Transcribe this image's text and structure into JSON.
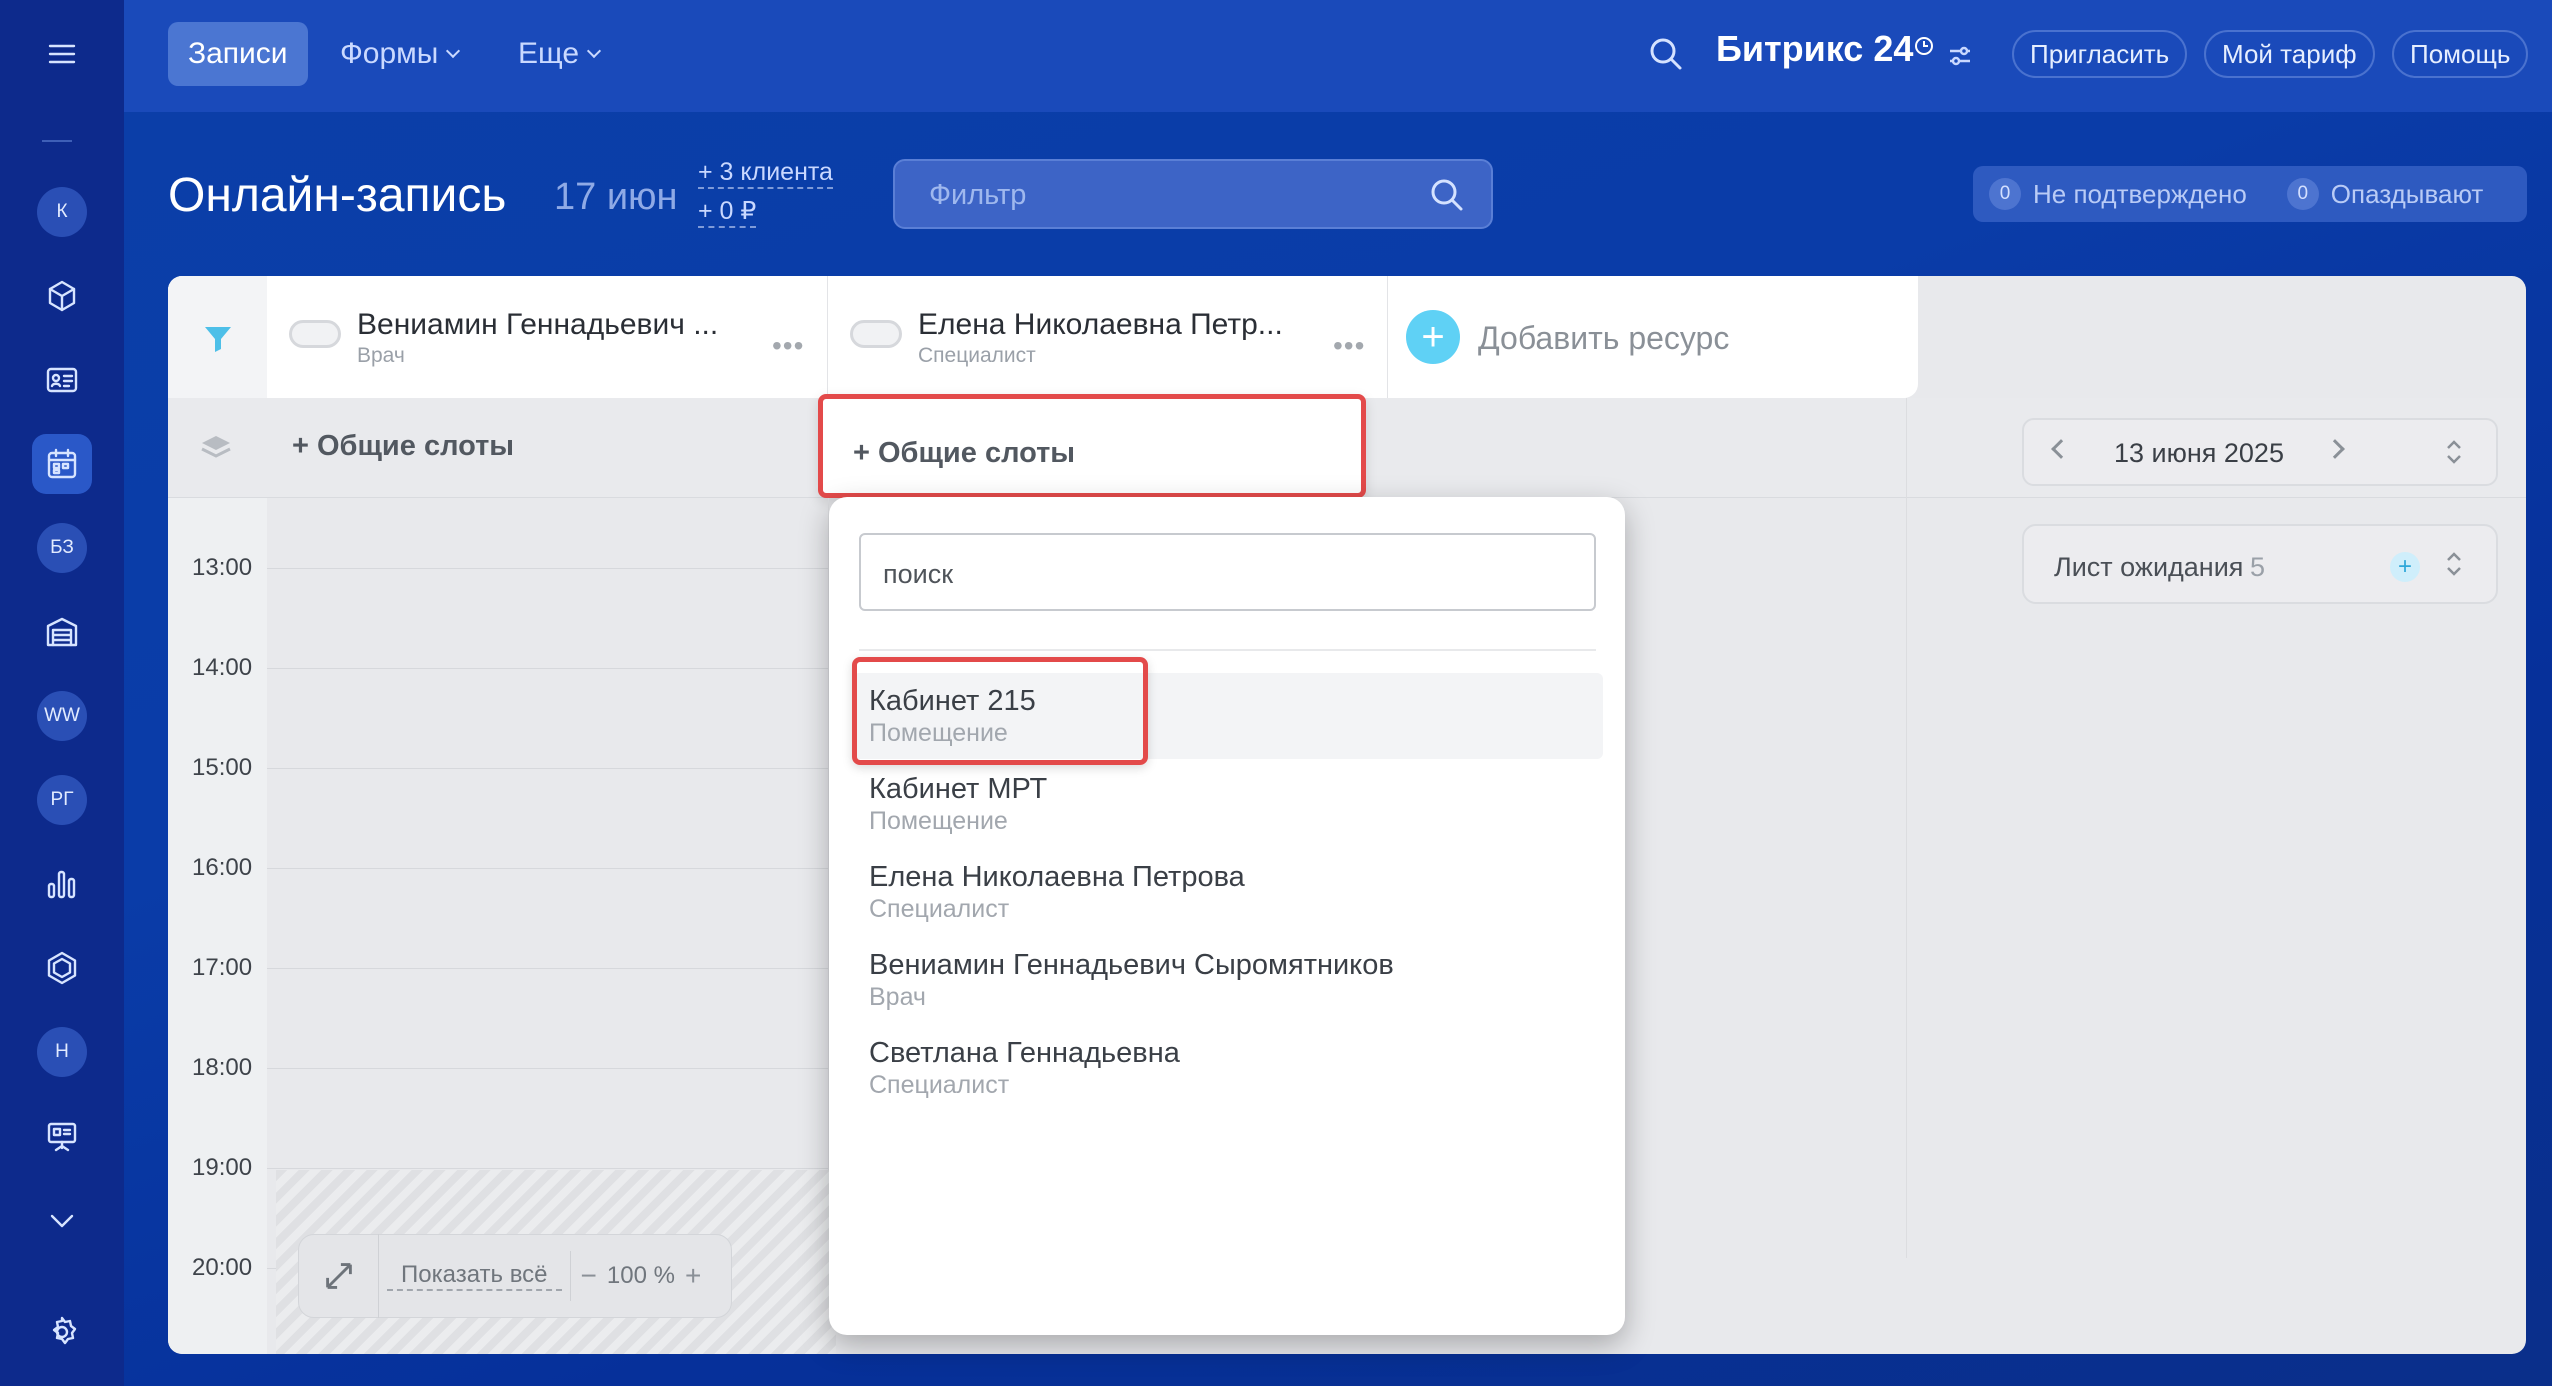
{
  "sidebar": {
    "items": [
      {
        "name": "menu-icon"
      },
      {
        "name": "avatar-k",
        "text": "К"
      },
      {
        "name": "cube-icon"
      },
      {
        "name": "contact-card-icon"
      },
      {
        "name": "booking-calendar-icon",
        "active": true
      },
      {
        "name": "avatar-bz",
        "text": "БЗ"
      },
      {
        "name": "warehouse-icon"
      },
      {
        "name": "avatar-ww",
        "text": "WW"
      },
      {
        "name": "avatar-rg",
        "text": "РГ"
      },
      {
        "name": "analytics-icon"
      },
      {
        "name": "hexagon-icon"
      },
      {
        "name": "avatar-n",
        "text": "Н"
      },
      {
        "name": "presentation-icon"
      },
      {
        "name": "chevron-down-icon"
      },
      {
        "name": "settings-icon"
      }
    ]
  },
  "topbar": {
    "tabs": [
      "Записи",
      "Формы",
      "Еще"
    ],
    "brand": "Битрикс",
    "brand_num": "24",
    "buttons": [
      "Пригласить",
      "Мой тариф",
      "Помощь"
    ]
  },
  "header": {
    "title": "Онлайн-запись",
    "date": "17 июн",
    "clients": "+ 3 клиента",
    "revenue": "+ 0 ₽",
    "filter_placeholder": "Фильтр",
    "counters": [
      {
        "count": "0",
        "label": "Не подтверждено"
      },
      {
        "count": "0",
        "label": "Опаздывают"
      }
    ]
  },
  "resources": [
    {
      "name": "Вениамин Геннадьевич ...",
      "role": "Врач"
    },
    {
      "name": "Елена Николаевна Петр...",
      "role": "Специалист"
    }
  ],
  "add_resource": "Добавить ресурс",
  "slots_label": "+ Общие слоты",
  "date_nav": {
    "date": "13 июня 2025"
  },
  "waitlist": {
    "label": "Лист ожидания",
    "count": "5"
  },
  "times": [
    "13:00",
    "14:00",
    "15:00",
    "16:00",
    "17:00",
    "18:00",
    "19:00",
    "20:00"
  ],
  "zoom": {
    "show_all": "Показать всё",
    "value": "100 %"
  },
  "dropdown": {
    "search_value": "поиск",
    "items": [
      {
        "name": "Кабинет 215",
        "type": "Помещение"
      },
      {
        "name": "Кабинет МРТ",
        "type": "Помещение"
      },
      {
        "name": "Елена Николаевна Петрова",
        "type": "Специалист"
      },
      {
        "name": "Вениамин Геннадьевич Сыромятников",
        "type": "Врач"
      },
      {
        "name": "Светлана Геннадьевна",
        "type": "Специалист"
      }
    ]
  },
  "colors": {
    "accent": "#5fd1f5",
    "highlight": "#e34a4a",
    "background": "#0b3fa8"
  }
}
